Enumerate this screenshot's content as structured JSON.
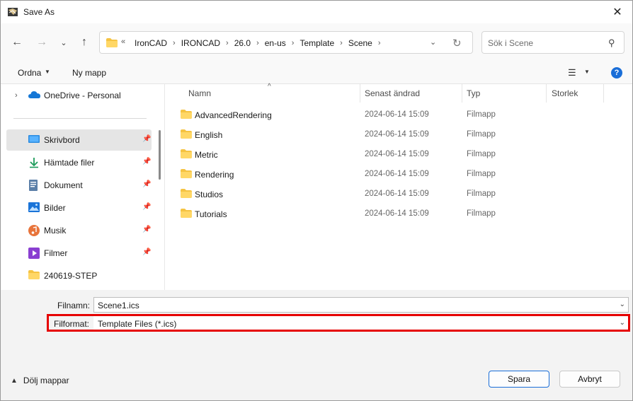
{
  "window": {
    "title": "Save As"
  },
  "navigation": {
    "breadcrumb_overflow": "«",
    "breadcrumbs": [
      "IronCAD",
      "IRONCAD",
      "26.0",
      "en-us",
      "Template",
      "Scene"
    ],
    "search_placeholder": "Sök i Scene"
  },
  "commandbar": {
    "organize_label": "Ordna",
    "new_folder_label": "Ny mapp"
  },
  "sidebar": {
    "items": [
      {
        "label": "OneDrive - Personal",
        "icon": "cloud-icon",
        "pinned": false
      },
      {
        "label": "Skrivbord",
        "icon": "desktop-icon",
        "pinned": true,
        "selected": true
      },
      {
        "label": "Hämtade filer",
        "icon": "download-icon",
        "pinned": true
      },
      {
        "label": "Dokument",
        "icon": "document-icon",
        "pinned": true
      },
      {
        "label": "Bilder",
        "icon": "pictures-icon",
        "pinned": true
      },
      {
        "label": "Musik",
        "icon": "music-icon",
        "pinned": true
      },
      {
        "label": "Filmer",
        "icon": "video-icon",
        "pinned": true
      },
      {
        "label": "240619-STEP",
        "icon": "folder-icon",
        "pinned": false
      }
    ]
  },
  "filelist": {
    "columns": [
      "Namn",
      "Senast ändrad",
      "Typ",
      "Storlek"
    ],
    "rows": [
      {
        "name": "AdvancedRendering",
        "modified": "2024-06-14 15:09",
        "type": "Filmapp"
      },
      {
        "name": "English",
        "modified": "2024-06-14 15:09",
        "type": "Filmapp"
      },
      {
        "name": "Metric",
        "modified": "2024-06-14 15:09",
        "type": "Filmapp"
      },
      {
        "name": "Rendering",
        "modified": "2024-06-14 15:09",
        "type": "Filmapp"
      },
      {
        "name": "Studios",
        "modified": "2024-06-14 15:09",
        "type": "Filmapp"
      },
      {
        "name": "Tutorials",
        "modified": "2024-06-14 15:09",
        "type": "Filmapp"
      }
    ]
  },
  "form": {
    "filename_label": "Filnamn:",
    "filename_value": "Scene1.ics",
    "filetype_label": "Filformat:",
    "filetype_value": "Template Files  (*.ics)"
  },
  "footer": {
    "hide_folders_label": "Dölj mappar",
    "save_label": "Spara",
    "cancel_label": "Avbryt"
  },
  "colors": {
    "accent": "#1a6ed8",
    "folder": "#f5c342",
    "highlight": "#e60000",
    "selected_bg": "#e5e5e5"
  }
}
